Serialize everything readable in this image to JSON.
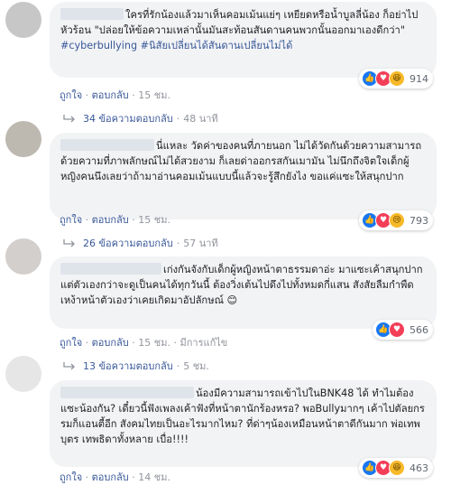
{
  "comments": [
    {
      "text": "ใครที่รักน้องแล้วมาเห็นคอมเม้นแย่ๆ เหยียดหรือน้ำบูลลี่น้อง ก็อย่าไปหัวร้อน \"ปล่อยให้ข้อความเหล่านั้นมันสะท้อนสันดานคนพวกนั้นออกมาเองดีกว่า\"",
      "tags": "#cyberbullying #นิสัยเปลี่ยนได้สันดานเปลี่ยนไม่ได้",
      "like": "ถูกใจ",
      "reply": "ตอบกลับ",
      "time": "15 ชม.",
      "edited": "",
      "reaction_count": "914",
      "replies_label": "34 ข้อความตอบกลับ",
      "replies_time": "48 นาที"
    },
    {
      "text": "นี่แหละ วัดค่าของคนที่ภายนอก ไม่ได้วัดกันด้วยความสามารถ ด้วยความที่ภาพลักษณ์ไม่ได้สวยงาม ก็เลยด่าออกรสกันเมามัน ไม่นึกถึงจิตใจเด็กผู้หญิงคนนึงเลยว่าถ้ามาอ่านคอมเม้นแบบนี้แล้วจะรู้สึกยังไง ขอแค่แซะให้สนุกปาก",
      "like": "ถูกใจ",
      "reply": "ตอบกลับ",
      "time": "15 ชม.",
      "edited": "",
      "reaction_count": "793",
      "replies_label": "26 ข้อความตอบกลับ",
      "replies_time": "57 นาที"
    },
    {
      "text": "เก่งกันจังกับเด็กผู้หญิงหน้าตาธรรมดาอ่ะ มาแซะเค้าสนุกปาก แต่ตัวเองกว่าจะดูเป็นคนได้ทุกวันนี้ ต้องวิ่งเต้นไปดึงไปทั้งหมดกี่แสน สังสัยลืมกำพืดเหง้าหน้าตัวเองว่าเคยเกิดมาอัปลักษณ์",
      "like": "ถูกใจ",
      "reply": "ตอบกลับ",
      "time": "15 ชม.",
      "edited": "มีการแก้ไข",
      "reaction_count": "566",
      "replies_label": "13 ข้อความตอบกลับ",
      "replies_time": "5 ชม."
    },
    {
      "text": "น้องมีความสามารถเข้าไปในBNK48 ได้ ทำไมต้องแซะน้องกัน? เดี๋ยวนี้ฟังเพลงเค้าฟังที่หน้าตานักร้องหรอ? พอBullyมากๆ เค้าไปตัลยกรรมก็แอนตี้อีก สังคมไทยเป็นอะไรมากไหม? ที่ด่าๆน้องเหมือนหน้าตาดีกันมาก พ่อเทพบุตร เทพธิดาทั้งหลาย เบื่อ!!!!",
      "like": "ถูกใจ",
      "reply": "ตอบกลับ",
      "time": "14 ชม.",
      "edited": "",
      "reaction_count": "463"
    }
  ]
}
